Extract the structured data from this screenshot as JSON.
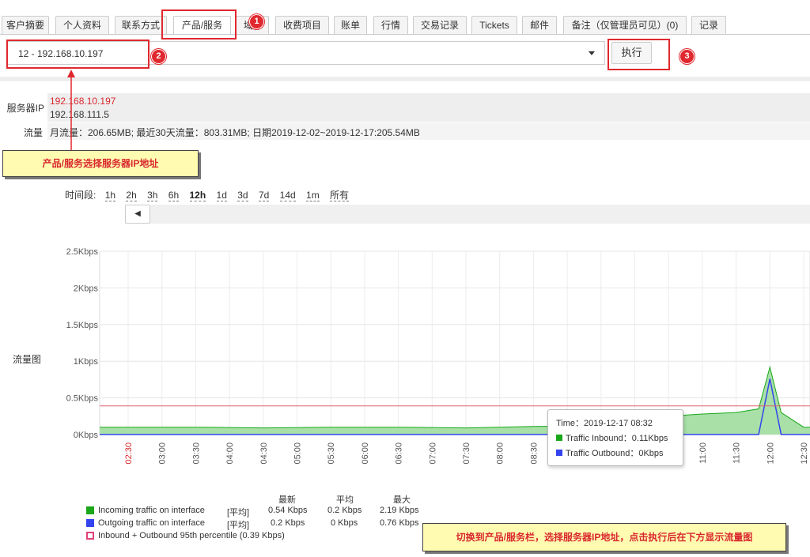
{
  "tabs": [
    {
      "label": "客户摘要"
    },
    {
      "label": "个人资料"
    },
    {
      "label": "联系方式"
    },
    {
      "label": "产品/服务"
    },
    {
      "label": "域"
    },
    {
      "label": "收费项目"
    },
    {
      "label": "账单"
    },
    {
      "label": "行情"
    },
    {
      "label": "交易记录"
    },
    {
      "label": "Tickets"
    },
    {
      "label": "邮件"
    },
    {
      "label": "备注（仅管理员可见）(0)"
    },
    {
      "label": "记录"
    }
  ],
  "callouts": [
    "1",
    "2",
    "3"
  ],
  "server_select": {
    "value": "12 - 192.168.10.197"
  },
  "execute_button": "执行",
  "info": {
    "server_ip_label": "服务器IP",
    "server_ip_primary": "192.168.10.197",
    "server_ip_secondary": "192.168.111.5",
    "traffic_label": "流量",
    "traffic_value": "月流量：206.65MB; 最近30天流量：803.31MB; 日期2019-12-02~2019-12-17:205.54MB"
  },
  "notes": {
    "select_ip": "产品/服务选择服务器IP地址",
    "instructions": "切换到产品/服务栏，选择服务器IP地址，点击执行后在下方显示流量图"
  },
  "period": {
    "label": "时间段:",
    "options": [
      "1h",
      "2h",
      "3h",
      "6h",
      "12h",
      "1d",
      "3d",
      "7d",
      "14d",
      "1m",
      "所有"
    ],
    "selected": "12h"
  },
  "chart_label": "流量图",
  "tooltip": {
    "time": "Time：2019-12-17 08:32",
    "inbound": "Traffic Inbound：0.11Kbps",
    "outbound": "Traffic Outbound：0Kbps"
  },
  "legend": {
    "headers": [
      "最新",
      "平均",
      "最大"
    ],
    "rows": [
      {
        "name": "Incoming traffic on interface",
        "fn": "[平均]",
        "last": "0.54 Kbps",
        "avg": "0.2 Kbps",
        "max": "2.19 Kbps",
        "color": "#1aa71a"
      },
      {
        "name": "Outgoing traffic on interface",
        "fn": "[平均]",
        "last": "0.2 Kbps",
        "avg": "0 Kbps",
        "max": "0.76 Kbps",
        "color": "#3344ee"
      },
      {
        "name": "Inbound + Outbound 95th percentile (0.39 Kbps)",
        "fn": "",
        "last": "",
        "avg": "",
        "max": "",
        "color": "#e0407a"
      }
    ]
  },
  "chart_data": {
    "type": "area",
    "yticks": [
      "0Kbps",
      "0.5Kbps",
      "1Kbps",
      "1.5Kbps",
      "2Kbps",
      "2.5Kbps"
    ],
    "ylim": [
      0,
      2.5
    ],
    "xticks": [
      "02:30",
      "03:00",
      "03:30",
      "04:00",
      "04:30",
      "05:00",
      "05:30",
      "06:00",
      "06:30",
      "07:00",
      "07:30",
      "08:00",
      "08:30",
      "09:00",
      "09:30",
      "10:00",
      "10:30",
      "11:00",
      "11:30",
      "12:00",
      "12:30"
    ],
    "first_tick_color": "#d9272e",
    "percentile_95": 0.39,
    "series": [
      {
        "name": "Incoming traffic on interface",
        "color": "#1aa71a",
        "fill": "#a8e0a8",
        "x": [
          "02:30",
          "03:30",
          "04:30",
          "05:30",
          "06:30",
          "07:30",
          "08:30",
          "09:30",
          "10:00",
          "10:30",
          "11:00",
          "11:30",
          "11:50",
          "12:00",
          "12:10",
          "12:30"
        ],
        "values": [
          0.1,
          0.1,
          0.09,
          0.1,
          0.1,
          0.09,
          0.11,
          0.12,
          0.2,
          0.25,
          0.28,
          0.3,
          0.35,
          0.92,
          0.3,
          0.1
        ]
      },
      {
        "name": "Outgoing traffic on interface",
        "color": "#3344ee",
        "x": [
          "02:30",
          "06:30",
          "10:30",
          "11:50",
          "12:00",
          "12:10",
          "12:30"
        ],
        "values": [
          0,
          0,
          0,
          0,
          0.76,
          0,
          0
        ]
      }
    ]
  }
}
